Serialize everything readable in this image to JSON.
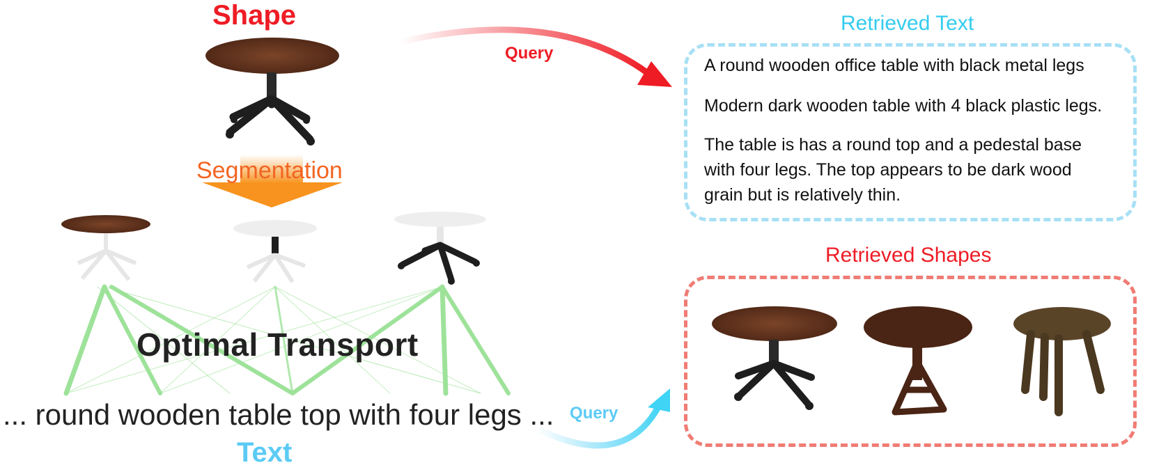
{
  "labels": {
    "shape": "Shape",
    "segmentation": "Segmentation",
    "optimal_transport": "Optimal Transport",
    "text_query": "... round wooden table top with four legs ...",
    "text": "Text",
    "query_shape": "Query",
    "query_text": "Query",
    "retrieved_text": "Retrieved Text",
    "retrieved_shapes": "Retrieved Shapes"
  },
  "retrieved_text_items": [
    "A round wooden office table with black metal legs",
    "Modern dark wooden table with 4 black plastic legs.",
    "The table is has a round top and a pedestal base",
    "with four legs. The top appears to be dark wood",
    "grain but is relatively thin."
  ],
  "colors": {
    "shape": "#ee1c25",
    "segmentation": "#f26522",
    "text": "#5bcbf5",
    "retrieved_text_border": "#a8e0f5",
    "retrieved_shapes_border": "#f07c74",
    "transport_lines": "#9ee29a",
    "wood": "#5a2e1a",
    "metal": "#1e1e1e"
  },
  "icons": [
    "round-table-shape",
    "segmentation-arrow",
    "table-top-part",
    "pedestal-part",
    "legs-part",
    "query-arrow"
  ]
}
